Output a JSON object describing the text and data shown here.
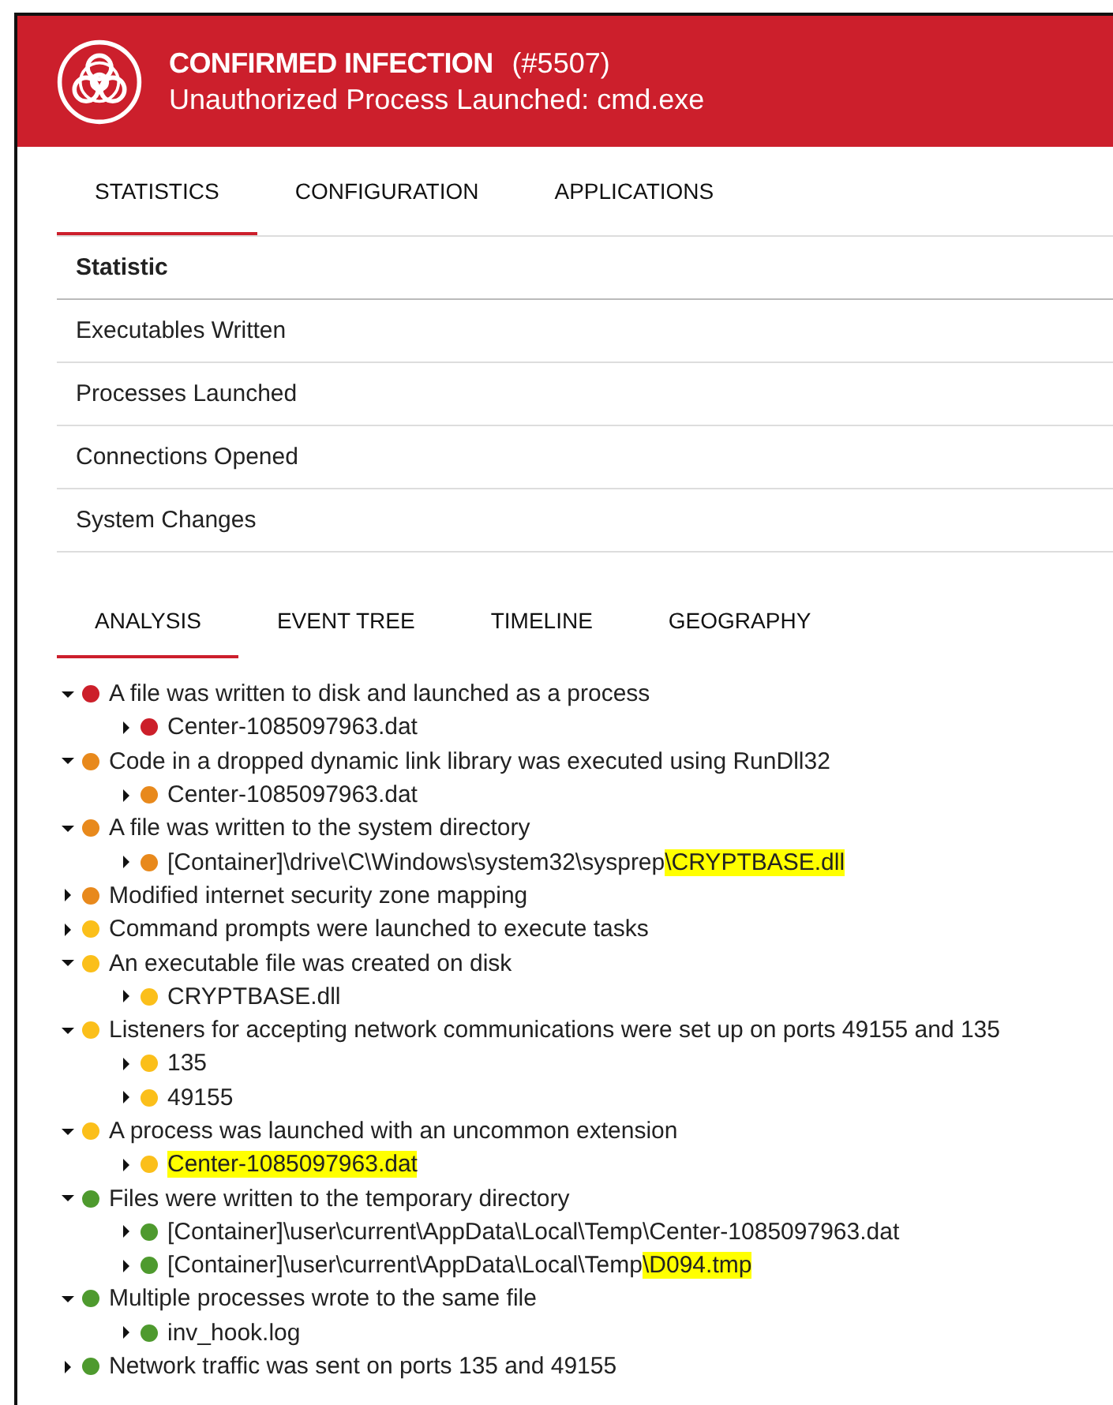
{
  "header": {
    "title": "CONFIRMED INFECTION",
    "id": "(#5507)",
    "subtitle": "Unauthorized Process Launched: cmd.exe"
  },
  "tabs": [
    {
      "label": "STATISTICS",
      "selected": true
    },
    {
      "label": "CONFIGURATION",
      "selected": false
    },
    {
      "label": "APPLICATIONS",
      "selected": false
    }
  ],
  "table": {
    "column": "Statistic",
    "rows": [
      "Executables Written",
      "Processes Launched",
      "Connections Opened",
      "System Changes"
    ]
  },
  "analysis_tabs": [
    {
      "label": "ANALYSIS",
      "selected": true
    },
    {
      "label": "EVENT TREE",
      "selected": false
    },
    {
      "label": "TIMELINE",
      "selected": false
    },
    {
      "label": "GEOGRAPHY",
      "selected": false
    }
  ],
  "tree": [
    {
      "text": "A file was written to disk and launched as a process",
      "color": "#cc1f2a",
      "expanded": true,
      "children": [
        {
          "text": "Center-1085097963.dat",
          "color": "#cc1f2a",
          "expanded": false
        }
      ]
    },
    {
      "text": "Code in a dropped dynamic link library was executed using RunDll32",
      "color": "#e8891c",
      "expanded": true,
      "children": [
        {
          "text": "Center-1085097963.dat",
          "color": "#e8891c",
          "expanded": false
        }
      ]
    },
    {
      "text": "A file was written to the system directory",
      "color": "#e8891c",
      "expanded": true,
      "children": [
        {
          "text": "[Container]\\drive\\C\\Windows\\system32\\sysprep",
          "highlight": "\\CRYPTBASE.dll",
          "color": "#e8891c",
          "expanded": false
        }
      ]
    },
    {
      "text": "Modified internet security zone mapping",
      "color": "#e8891c",
      "expanded": false
    },
    {
      "text": "Command prompts were launched to execute tasks",
      "color": "#fbbf1a",
      "expanded": false
    },
    {
      "text": "An executable file was created on disk",
      "color": "#fbbf1a",
      "expanded": true,
      "children": [
        {
          "text": "CRYPTBASE.dll",
          "color": "#fbbf1a",
          "expanded": false
        }
      ]
    },
    {
      "text": "Listeners for accepting network communications were set up on ports 49155 and 135",
      "color": "#fbbf1a",
      "expanded": true,
      "children": [
        {
          "text": "135",
          "color": "#fbbf1a",
          "expanded": false
        },
        {
          "text": "49155",
          "color": "#fbbf1a",
          "expanded": false
        }
      ]
    },
    {
      "text": "A process was launched with an uncommon extension",
      "color": "#fbbf1a",
      "expanded": true,
      "children": [
        {
          "highlight": "Center-1085097963.dat",
          "color": "#fbbf1a",
          "expanded": false
        }
      ]
    },
    {
      "text": "Files were written to the temporary directory",
      "color": "#4e9a2e",
      "expanded": true,
      "children": [
        {
          "text": "[Container]\\user\\current\\AppData\\Local\\Temp\\Center-1085097963.dat",
          "color": "#4e9a2e",
          "expanded": false
        },
        {
          "text": "[Container]\\user\\current\\AppData\\Local\\Temp",
          "highlight": "\\D094.tmp",
          "color": "#4e9a2e",
          "expanded": false
        }
      ]
    },
    {
      "text": "Multiple processes wrote to the same file",
      "color": "#4e9a2e",
      "expanded": true,
      "children": [
        {
          "text": "inv_hook.log",
          "color": "#4e9a2e",
          "expanded": false
        }
      ]
    },
    {
      "text": "Network traffic was sent on ports 135 and 49155",
      "color": "#4e9a2e",
      "expanded": false
    }
  ]
}
